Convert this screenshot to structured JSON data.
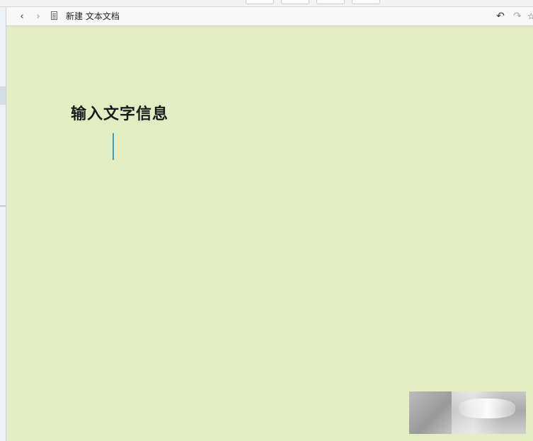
{
  "toolbar": {
    "back_icon": "chevron-left",
    "forward_icon": "chevron-right",
    "document_icon": "document-icon",
    "title": "新建 文本文档",
    "undo_icon": "undo-arrow",
    "redo_icon": "redo-arrow",
    "back_glyph": "‹",
    "forward_glyph": "›",
    "undo_glyph": "↶",
    "redo_glyph": "↷",
    "extra_glyph": "☆"
  },
  "editor": {
    "content": "输入文字信息",
    "background_color": "#e2edc4",
    "caret_color": "#3aa0c6"
  }
}
